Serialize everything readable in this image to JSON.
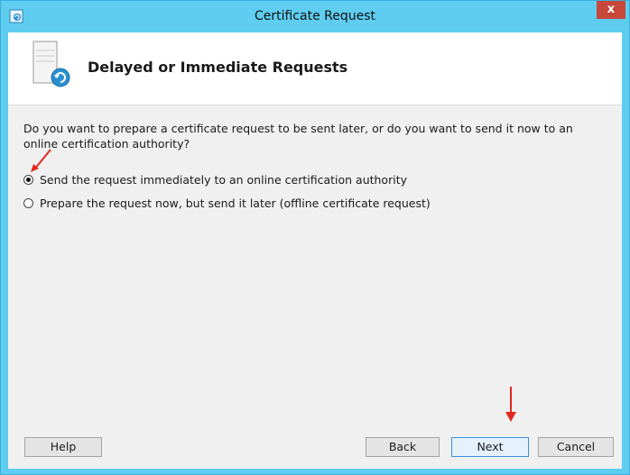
{
  "window": {
    "title": "Certificate Request",
    "close_label": "x"
  },
  "header": {
    "title": "Delayed or Immediate Requests"
  },
  "content": {
    "question": "Do you want to prepare a certificate request to be sent later, or do you want to send it now to an online certification authority?",
    "options": [
      {
        "label": "Send the request immediately to an online certification authority",
        "selected": true
      },
      {
        "label": "Prepare the request now, but send it later (offline certificate request)",
        "selected": false
      }
    ]
  },
  "footer": {
    "help": "Help",
    "back": "Back",
    "next": "Next",
    "cancel": "Cancel"
  },
  "colors": {
    "titlebar": "#5ecdf0",
    "close": "#c7473b",
    "annotation": "#e0281e"
  }
}
